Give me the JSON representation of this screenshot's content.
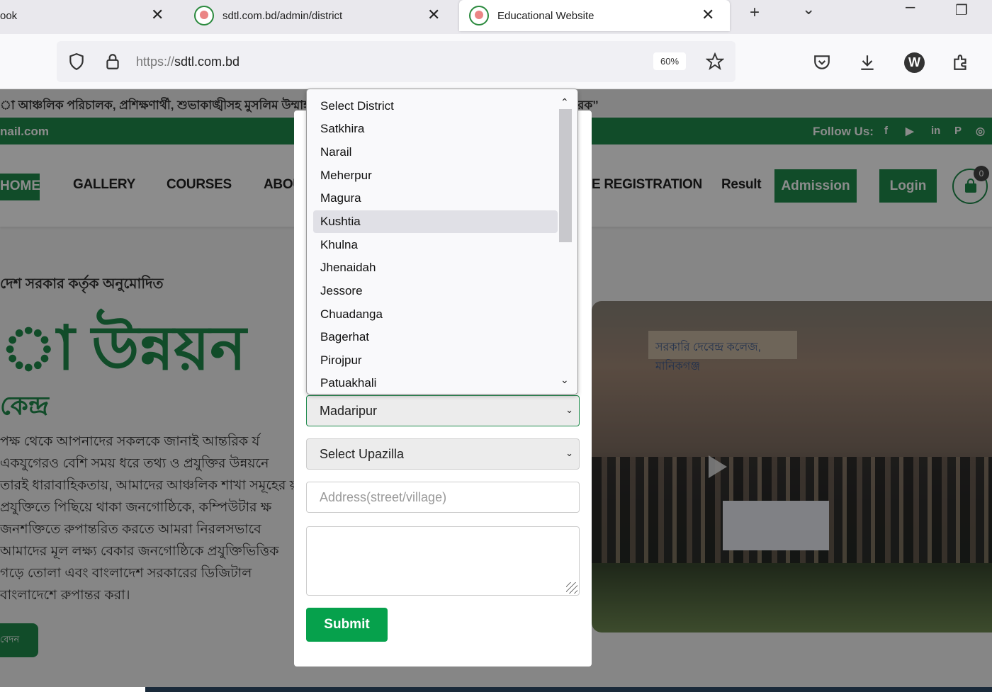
{
  "browser": {
    "tabs": [
      {
        "title": "ook",
        "active": false
      },
      {
        "title": "sdtl.com.bd/admin/district",
        "active": false
      },
      {
        "title": "Educational Website",
        "active": true
      }
    ],
    "url_proto": "https://",
    "url_host": "sdtl.com.bd",
    "zoom": "60%",
    "account_initial": "W"
  },
  "page": {
    "marquee": "া আঞ্চলিক পরিচালক, প্রশিক্ষণার্থী, শুভাকাঙ্খীসহ মুসলিম উম্মাহর প্রতি",
    "marquee_tail": "রক”",
    "email": "nail.com",
    "follow_label": "Follow Us:",
    "social_icons": [
      "facebook-icon",
      "youtube-icon",
      "linkedin-icon",
      "pinterest-icon",
      "whatsapp-icon"
    ],
    "menu": {
      "home": "HOME",
      "gallery": "GALLERY",
      "courses": "COURSES",
      "about": "ABOU",
      "registration": "E REGISTRATION",
      "result": "Result",
      "admission": "Admission",
      "login": "Login",
      "cart_count": "0"
    },
    "hero": {
      "approved": "দেশ সরকার কর্তৃক অনুমোদিত",
      "title": "া উন্নয়ন",
      "subtitle": "কেন্দ্র",
      "paragraph": "পক্ষ থেকে আপনাদের সকলকে জানাই আন্তরিক র্য একযুগেরও বেশি সময় ধরে তথ্য ও প্রযুক্তির উন্নয়নে তারই ধারাবাহিকতায়, আমাদের আঞ্চলিক শাখা সমূহের য় প্রযুক্তিতে পিছিয়ে থাকা জনগোষ্ঠিকে, কম্পিউটার ক্ষ জনশক্তিতে রুপান্তরিত করতে আমরা নিরলসভাবে আমাদের মূল লক্ষ্য বেকার জনগোষ্ঠিকে প্রযুক্তিভিত্তিক গড়ে তোলা এবং বাংলাদেশ সরকারের ডিজিটাল বাংলাদেশে রুপান্তর করা।",
      "apply": "বেদন"
    },
    "video_sign": "সরকারি দেবেন্দ্র কলেজ, মানিকগঞ্জ"
  },
  "form": {
    "district_selected": "Madaripur",
    "upazilla_placeholder": "Select Upazilla",
    "address_placeholder": "Address(street/village)",
    "submit_label": "Submit",
    "district_options": [
      "Select District",
      "Satkhira",
      "Narail",
      "Meherpur",
      "Magura",
      "Kushtia",
      "Khulna",
      "Jhenaidah",
      "Jessore",
      "Chuadanga",
      "Bagerhat",
      "Pirojpur",
      "Patuakhali"
    ],
    "highlighted_option": "Kushtia"
  }
}
